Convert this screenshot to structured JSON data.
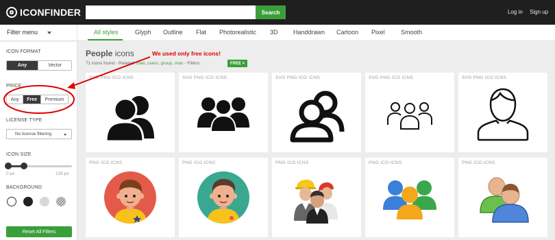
{
  "app": {
    "logo_text": "ICONFINDER"
  },
  "header": {
    "search_placeholder": "",
    "search_button": "Search",
    "login": "Log in",
    "signup": "Sign up"
  },
  "filter_menu": {
    "label": "Filter menu"
  },
  "style_tabs": [
    "All styles",
    "Glyph",
    "Outline",
    "Flat",
    "Photorealistic",
    "3D",
    "Handdrawn",
    "Cartoon",
    "Pixel",
    "Smooth"
  ],
  "active_tab": "All styles",
  "sidebar": {
    "icon_format": {
      "label": "ICON FORMAT",
      "options": [
        "Any",
        "Vector"
      ],
      "selected": "Any"
    },
    "price": {
      "label": "PRICE",
      "options": [
        "Any",
        "Free",
        "Premium"
      ],
      "selected": "Free"
    },
    "license": {
      "label": "LICENSE TYPE",
      "value": "No license filtering"
    },
    "icon_size": {
      "label": "ICON SIZE",
      "min_label": "0 px",
      "max_label": "128 px"
    },
    "background": {
      "label": "BACKGROUND",
      "options": [
        "white",
        "black",
        "grey",
        "transparent"
      ]
    },
    "reset_button": "Reset All Filters"
  },
  "results": {
    "title_bold": "People",
    "title_rest": " icons",
    "count_text": "71 icons found - Related: ",
    "related": [
      "user",
      "users",
      "group",
      "man"
    ],
    "filters_text": " - Filters: ",
    "filter_chip": "FREE ×"
  },
  "cards": [
    {
      "formats": "SVG  PNG  ICO  ICNS",
      "icon": "two-people-glyph-icon"
    },
    {
      "formats": "SVG  PNG  ICO  ICNS",
      "icon": "three-people-glyph-icon"
    },
    {
      "formats": "SVG  PNG  ICO  ICNS",
      "icon": "two-people-bold-outline-icon"
    },
    {
      "formats": "SVG  PNG  ICO  ICNS",
      "icon": "three-people-outline-icon"
    },
    {
      "formats": "SVG  PNG  ICO  ICNS",
      "icon": "person-outline-icon"
    },
    {
      "formats": "PNG  ICO  ICNS",
      "icon": "boy-avatar-red-icon"
    },
    {
      "formats": "PNG  ICO  ICNS",
      "icon": "boy-avatar-teal-icon"
    },
    {
      "formats": "PNG  ICO  ICNS",
      "icon": "workers-photorealistic-icon"
    },
    {
      "formats": "PNG  ICO  ICNS",
      "icon": "users-group-colorful-icon"
    },
    {
      "formats": "PNG  ICO  ICNS",
      "icon": "two-users-glossy-icon"
    }
  ],
  "annotation": {
    "text": "We used only free icons!",
    "color": "#e00000"
  },
  "colors": {
    "accent": "#3a9f3a",
    "topbar": "#1f1f1f",
    "annotation": "#e00000"
  }
}
